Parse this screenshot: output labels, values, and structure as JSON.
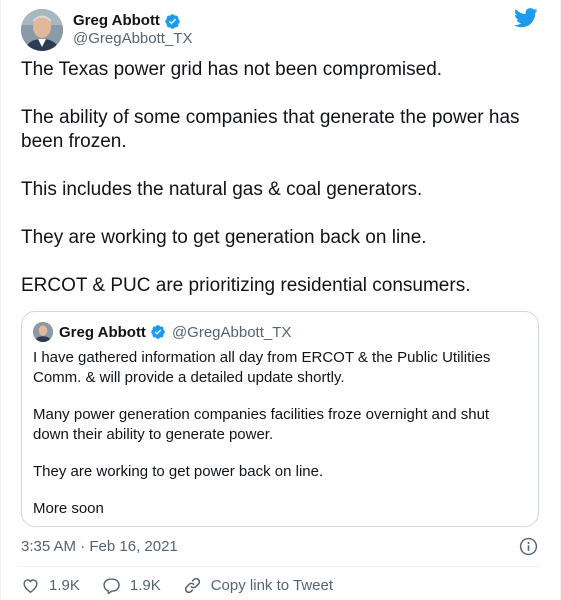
{
  "author": {
    "display_name": "Greg Abbott",
    "handle": "@GregAbbott_TX"
  },
  "tweet": {
    "paragraphs": [
      "The Texas power grid has not been compromised.",
      "The ability of some companies that generate the power has been frozen.",
      "This includes the natural gas & coal generators.",
      "They are working to get generation back on line.",
      "ERCOT & PUC are prioritizing residential consumers."
    ],
    "timestamp": "3:35 AM · Feb 16, 2021"
  },
  "quoted": {
    "display_name": "Greg Abbott",
    "handle": "@GregAbbott_TX",
    "paragraphs": [
      "I have gathered information all day from ERCOT & the Public Utilities Comm. & will provide a detailed update shortly.",
      "Many power generation companies facilities froze overnight and shut down their ability to generate power.",
      "They are working to get power back on line.",
      "More soon"
    ]
  },
  "actions": {
    "likes": "1.9K",
    "replies": "1.9K",
    "copy_link": "Copy link to Tweet"
  },
  "colors": {
    "twitter_blue": "#1d9bf0",
    "text_primary": "#0f1419",
    "text_secondary": "#536471",
    "border": "#cfd9de"
  },
  "icons": {
    "brand": "twitter-bird-icon",
    "verified": "verified-badge-icon",
    "info": "info-icon",
    "like": "heart-icon",
    "reply": "reply-bubble-icon",
    "copy_link": "link-icon"
  }
}
